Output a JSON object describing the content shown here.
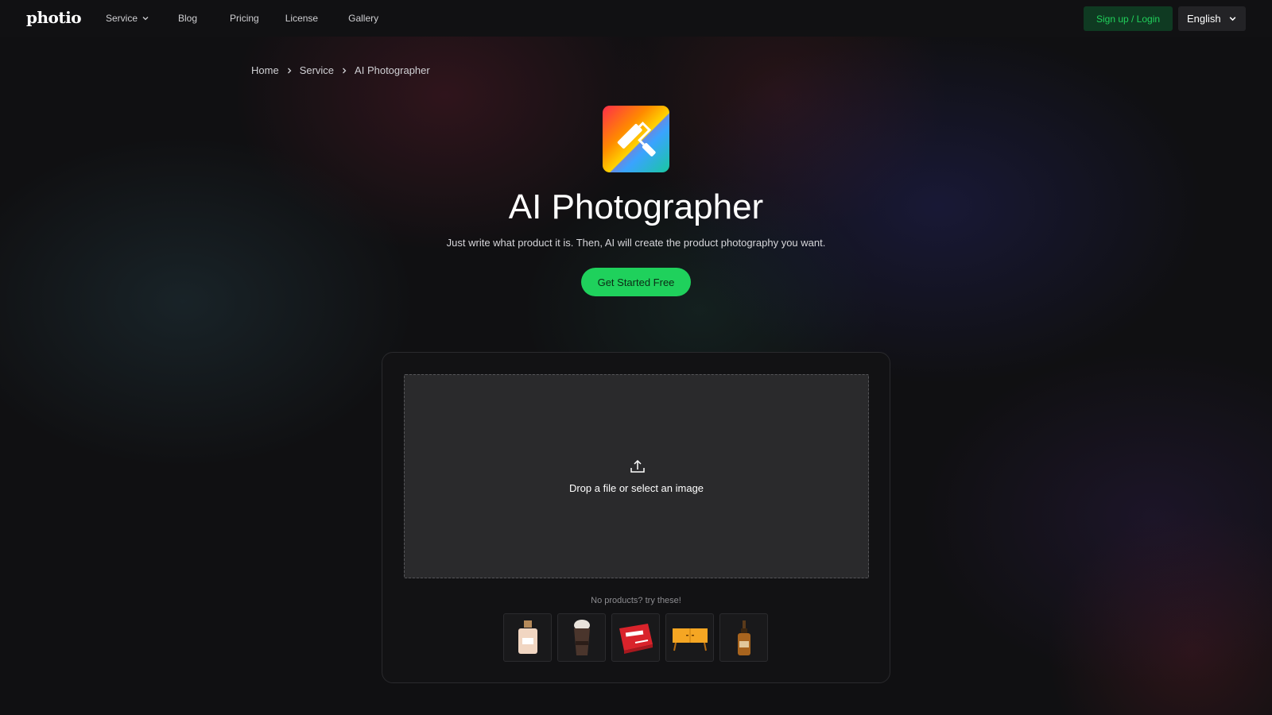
{
  "nav": {
    "logo": "photio",
    "links": [
      {
        "label": "Service"
      },
      {
        "label": "Blog"
      },
      {
        "label": "Pricing"
      },
      {
        "label": "License"
      },
      {
        "label": "Gallery"
      }
    ],
    "signup_label": "Sign up / Login",
    "language": "English"
  },
  "breadcrumb": [
    "Home",
    "Service",
    "AI Photographer"
  ],
  "hero": {
    "title": "AI Photographer",
    "subtitle": "Just write what product it is. Then, AI will create the product photography you want.",
    "cta_label": "Get Started Free"
  },
  "upload": {
    "drop_text": "Drop a file or select an image",
    "try_text": "No products? try these!"
  },
  "samples": [
    {
      "icon": "perfume-bottle-icon"
    },
    {
      "icon": "iced-coffee-icon"
    },
    {
      "icon": "medicine-box-icon"
    },
    {
      "icon": "sideboard-icon"
    },
    {
      "icon": "dropper-bottle-icon"
    }
  ],
  "colors": {
    "accent": "#1fd15c",
    "signup_bg": "#0f3a22",
    "signup_text": "#21d05b",
    "background": "#101012",
    "card_bg": "#121214",
    "dropzone_bg": "#2a2a2c"
  }
}
